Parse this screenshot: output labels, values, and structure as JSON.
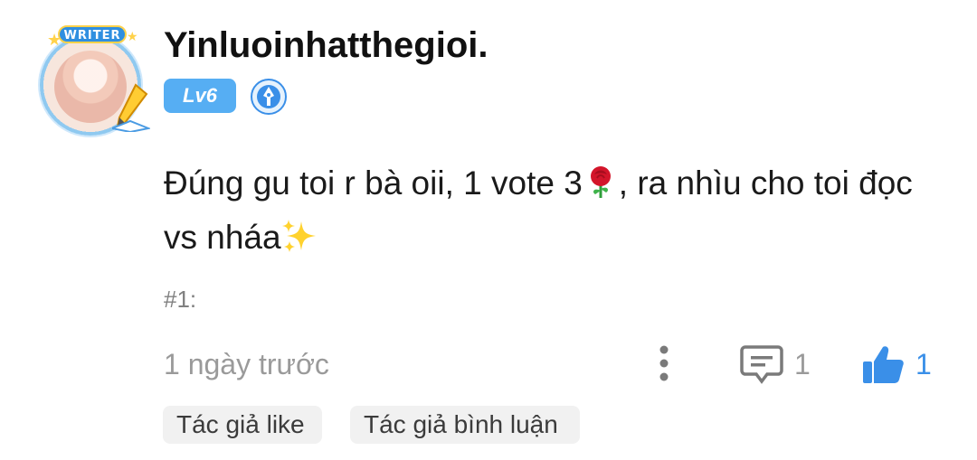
{
  "user": {
    "name": "Yinluoinhatthegioi.",
    "level": "Lv6",
    "avatar_badge": "WRITER"
  },
  "comment": {
    "part1": "Đúng gu toi r bà oii, 1 vote 3",
    "part2": ", ra nhìu cho toi đọc vs nháa",
    "ref": "#1:",
    "emojis": [
      "rose-icon",
      "sparkles-icon"
    ]
  },
  "footer": {
    "time": "1 ngày trước",
    "reply_count": "1",
    "like_count": "1"
  },
  "tags": [
    "Tác giả like",
    "Tác giả bình luận"
  ],
  "colors": {
    "accent": "#3a8fe8",
    "level_badge": "#56aef3",
    "muted_text": "#9a9a9a",
    "tag_bg": "#f1f1f1"
  }
}
